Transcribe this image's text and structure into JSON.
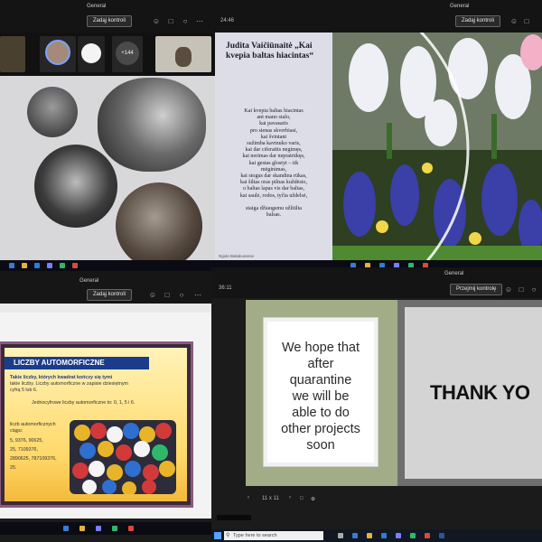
{
  "colors": {
    "teams_bar": "#141414",
    "poem_panel": "#dcdde7",
    "slide_title_blue": "#1b3c8c",
    "slide_green": "#a2ad87",
    "slide_gray": "#d4d4d4"
  },
  "q1": {
    "title": "General",
    "control_label": "Zadąj kontroli",
    "participant_badge": "+144",
    "icons": [
      "people-icon",
      "chat-icon",
      "hand-icon",
      "more-icon"
    ]
  },
  "q2": {
    "title": "General",
    "timer": "24:46",
    "control_label": "Zadąj kontroli",
    "poem_title": "Judita Vaičiūnaitė „Kai kvepia baltas hiacintas“",
    "poem_lines": [
      "Kai kvepia baltas hiacintas",
      "ant mano stalo,",
      "kai pavasaris",
      "pro sienas skverbiasi,",
      "kai švintant",
      "sužimba kavinuko varis,",
      "kai dar ciferaitis negimęs,",
      "kai nerimas dar nepratrūkęs,",
      "kai gestas glostyt – tik",
      "mėginimas,",
      "kai stogus dar skandina rūkas,",
      "kai šiltas oras pilnas kuždėsio,",
      "o baltas lapas vis dar baltas,",
      "kai saulė, rodos, tyčia uždelsė,",
      "",
      "staiga džiaugsmu užliūlta",
      "balsas."
    ],
    "presenter_label": "Ngole Bakaluosene"
  },
  "q3": {
    "title": "General",
    "control_label": "Zadąj kontroli",
    "slide_title": "LICZBY AUTOMORFICZNE",
    "line1_a": "Takie liczby, których kwadrat kończy się tymi",
    "line1_b": "takie liczby. Liczby automorficzne w zapisie dziesiętnym",
    "line1_c": "cyfrą 5 lub 6.",
    "line2": "Jednocyfrowe liczby automorficzne to: 0, 1, 5 i 6.",
    "list_a": "liczb automorficznych",
    "list_b": "ciągu:",
    "list_c": "5, 9376, 90625,",
    "list_d": "25, 7109376,",
    "list_e": "2890625, 787109376,",
    "list_f": "25."
  },
  "q4": {
    "title": "General",
    "timer": "36:11",
    "control_label": "Przejmij kontrolę",
    "hope_lines": [
      "We hope that",
      "after",
      "quarantine",
      "we will be",
      "able to do",
      "other projects",
      "soon"
    ],
    "thank_text": "THANK YO",
    "page_indicator": "11 x 11",
    "search_placeholder": "Type here to search"
  }
}
